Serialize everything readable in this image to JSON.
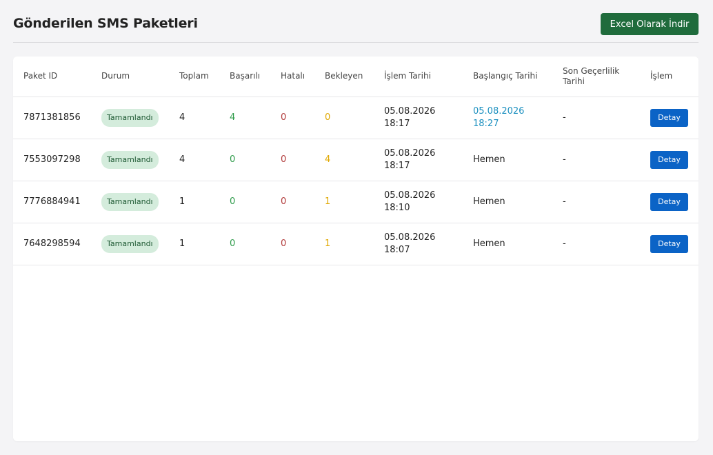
{
  "header": {
    "title": "Gönderilen SMS Paketleri",
    "excel_label": "Excel Olarak İndir"
  },
  "table": {
    "columns": [
      "Paket ID",
      "Durum",
      "Toplam",
      "Başarılı",
      "Hatalı",
      "Bekleyen",
      "İşlem Tarihi",
      "Başlangıç Tarihi",
      "Son Geçerlilik Tarihi",
      "İşlem"
    ],
    "rows": [
      {
        "id": "7871381856",
        "status": "Tamamlandı",
        "total": "4",
        "success": "4",
        "failed": "0",
        "pending": "0",
        "date": "05.08.2026",
        "time": "18:17",
        "start_date": "05.08.2026",
        "start_time": "18:27",
        "expiry": "-",
        "action": "Detay"
      },
      {
        "id": "7553097298",
        "status": "Tamamlandı",
        "total": "4",
        "success": "0",
        "failed": "0",
        "pending": "4",
        "date": "05.08.2026",
        "time": "18:17",
        "start": "Hemen",
        "expiry": "-",
        "action": "Detay"
      },
      {
        "id": "7776884941",
        "status": "Tamamlandı",
        "total": "1",
        "success": "0",
        "failed": "0",
        "pending": "1",
        "date": "05.08.2026",
        "time": "18:10",
        "start": "Hemen",
        "expiry": "-",
        "action": "Detay"
      },
      {
        "id": "7648298594",
        "status": "Tamamlandı",
        "total": "1",
        "success": "0",
        "failed": "0",
        "pending": "1",
        "date": "05.08.2026",
        "time": "18:07",
        "start": "Hemen",
        "expiry": "-",
        "action": "Detay"
      }
    ]
  },
  "colors": {
    "success": "#2e9b4a",
    "failed": "#b13a3a",
    "pending": "#e0a800",
    "link": "#1a8fbf",
    "primary_button": "#0b63c6",
    "excel_button": "#1f6b3c",
    "badge_bg": "#d4ecdc"
  }
}
